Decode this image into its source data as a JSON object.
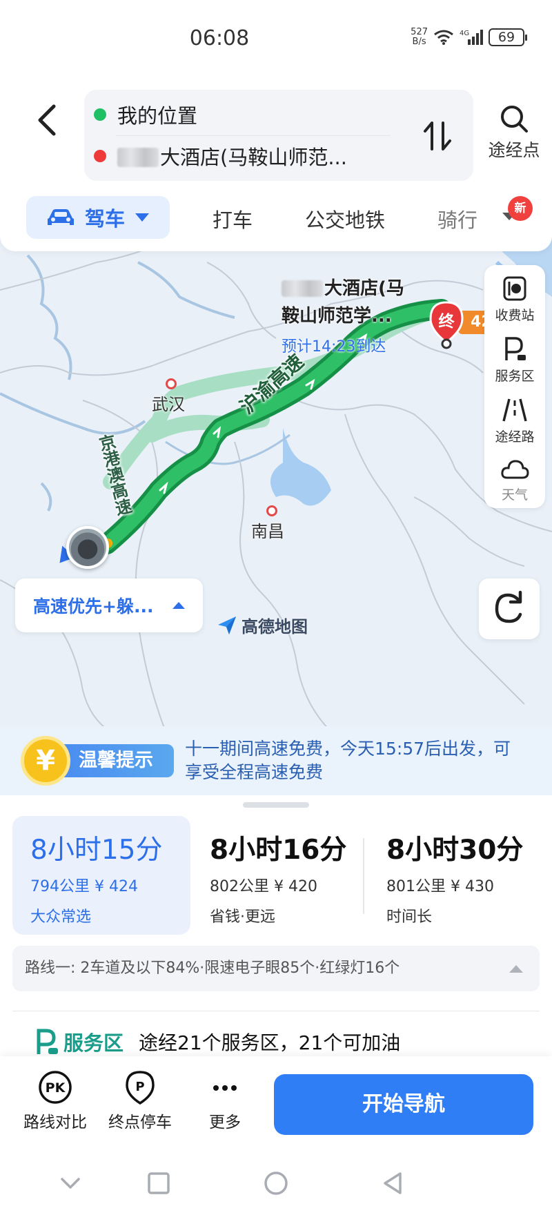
{
  "status": {
    "time": "06:08",
    "net_speed_value": "527",
    "net_speed_unit": "B/s",
    "network": "4G",
    "battery": "69"
  },
  "search": {
    "origin": "我的位置",
    "destination": "大酒店(马鞍山师范...",
    "via_label": "途经点"
  },
  "tabs": {
    "drive": "驾车",
    "taxi": "打车",
    "transit": "公交地铁",
    "ride": "骑行",
    "new_badge": "新"
  },
  "map": {
    "dest_name": "大酒店(马鞍山师范学...",
    "eta": "预计14:23到达",
    "pin_label": "终",
    "dest_distance": "42",
    "city_wuhan": "武汉",
    "city_nanchang": "南昌",
    "road_main": "沪渝高速",
    "road_alt": "京港澳高速",
    "watermark": "高德地图",
    "route_pref": "高速优先+躲...",
    "tools": {
      "toll": "收费站",
      "service": "服务区",
      "via_road": "途经路",
      "weather": "天气"
    }
  },
  "notice": {
    "tag": "温馨提示",
    "text": "十一期间高速免费，今天15:57后出发，可享受全程高速免费"
  },
  "routes": [
    {
      "time": "8小时15分",
      "meta": "794公里 ¥ 424",
      "tag": "大众常选"
    },
    {
      "time": "8小时16分",
      "meta": "802公里 ¥ 420",
      "tag": "省钱·更远"
    },
    {
      "time": "8小时30分",
      "meta": "801公里 ¥ 430",
      "tag": "时间长"
    }
  ],
  "route_detail": "路线一:  2车道及以下84%·限速电子眼85个·红绿灯16个",
  "service": {
    "tag": "服务区",
    "text": "途经21个服务区，21个可加油"
  },
  "bottom": {
    "compare": "路线对比",
    "parking": "终点停车",
    "more": "更多",
    "start": "开始导航"
  },
  "colors": {
    "accent": "#2f7ef6",
    "route_main": "#1fa855",
    "route_alt": "#a6dcbf",
    "notice_bg": "#eaf2fc"
  }
}
